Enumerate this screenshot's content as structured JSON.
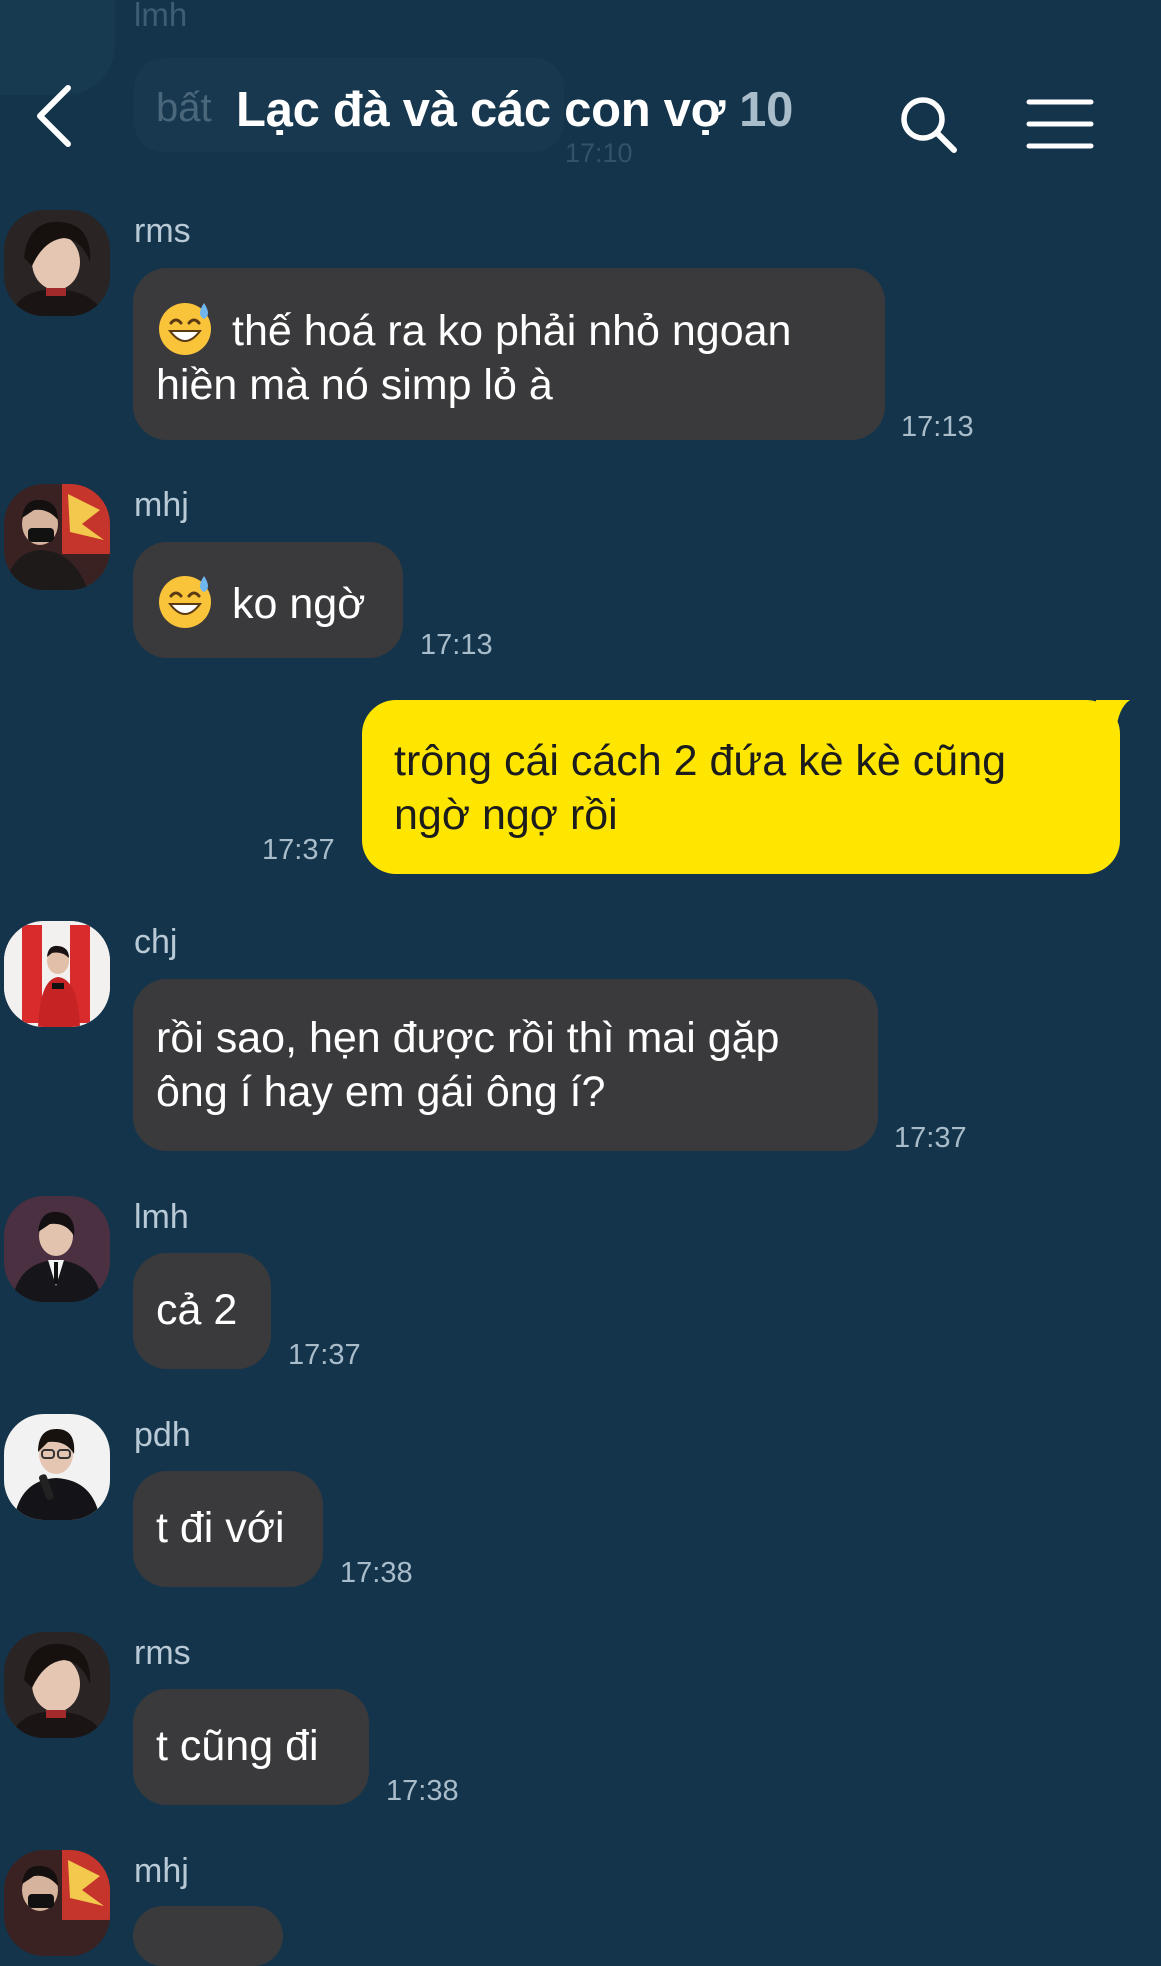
{
  "header": {
    "title": "Lạc đà và các con vợ",
    "member_count": "10",
    "back_icon": "chevron-left-icon",
    "search_icon": "search-icon",
    "menu_icon": "menu-icon"
  },
  "background_message": {
    "sender": "lmh",
    "text": "bất",
    "time": "17:10"
  },
  "messages": [
    {
      "sender": "rms",
      "text_line1": "thế hoá ra ko phải nhỏ ngoan",
      "text_line2": "hiền mà nó simp lỏ à",
      "emoji": "sweat-smile-emoji",
      "time": "17:13"
    },
    {
      "sender": "mhj",
      "text": "ko ngờ",
      "emoji": "sweat-smile-emoji",
      "time": "17:13"
    },
    {
      "sender": "me",
      "text_line1": "trông cái cách 2 đứa kè kè cũng",
      "text_line2": "ngờ ngợ rồi",
      "time": "17:37"
    },
    {
      "sender": "chj",
      "text_line1": "rồi sao, hẹn được rồi thì mai gặp",
      "text_line2": "ông í hay em gái ông í?",
      "time": "17:37"
    },
    {
      "sender": "lmh",
      "text": "cả 2",
      "time": "17:37"
    },
    {
      "sender": "pdh",
      "text": "t đi với",
      "time": "17:38"
    },
    {
      "sender": "rms",
      "text": "t cũng đi",
      "time": "17:38"
    },
    {
      "sender": "mhj"
    }
  ],
  "colors": {
    "background": "#13344b",
    "bubble_other": "#3a3a3c",
    "bubble_mine": "#ffe600"
  }
}
